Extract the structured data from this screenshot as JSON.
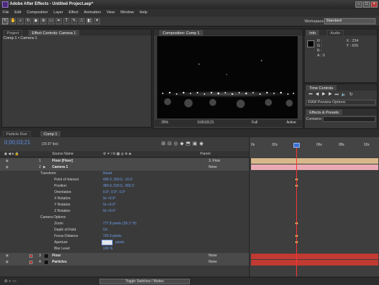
{
  "window": {
    "title": "Adobe After Effects - Untitled Project.aep*",
    "buttons": [
      "–",
      "□",
      "×"
    ]
  },
  "menu": [
    "File",
    "Edit",
    "Composition",
    "Layer",
    "Effect",
    "Animation",
    "View",
    "Window",
    "Help"
  ],
  "toolbar": {
    "tools": [
      "selection-tool",
      "hand-tool",
      "zoom-tool",
      "rotation-tool",
      "camera-tool",
      "pan-behind-tool",
      "mask-tool",
      "pen-tool",
      "text-tool",
      "brush-tool",
      "clone-stamp-tool",
      "eraser-tool",
      "puppet-tool"
    ],
    "workspace_label": "Workspace:",
    "workspace_value": "Standard"
  },
  "project_panel": {
    "tabs": [
      "Project",
      "Effect Controls: Camera 1"
    ],
    "breadcrumb": "Comp 1 • Camera 1"
  },
  "comp_panel": {
    "tab": "Composition: Comp 1",
    "footer": {
      "zoom": "25%",
      "timecode": "0;00;03;21",
      "resolution": "Full",
      "view": "Active"
    }
  },
  "info_panel": {
    "tabs": [
      "Info",
      "Audio"
    ],
    "r": "R :",
    "g": "G :",
    "b": "B :",
    "a": "A : 0",
    "x": "X : 234",
    "y": "Y : 605"
  },
  "time_controls": {
    "tab": "Time Controls",
    "ram_preview": "RAM Preview Options"
  },
  "effects_panel": {
    "tab": "Effects & Presets",
    "contains_label": "Contains:"
  },
  "lower_tabs": [
    "Particle Run",
    "Comp 1"
  ],
  "timeline": {
    "timecode": "0;00;03;21",
    "fps": "(29.97 fps)",
    "columns": {
      "source": "Source Name",
      "parent": "Parent"
    },
    "ruler_labels": [
      "0s",
      "02s",
      "04s",
      "06s",
      "08s",
      "10s"
    ],
    "rows": [
      {
        "num": "1",
        "name": "Floor [Floor]",
        "parent": "3. Floor"
      },
      {
        "num": "2",
        "name": "Camera 1",
        "parent": "None"
      },
      {
        "prop": "Transform",
        "value": "Reset"
      },
      {
        "prop": "Point of Interest",
        "value": "495.0, 369.0, -16.0"
      },
      {
        "prop": "Position",
        "value": "384.0, 520.0, -992.0"
      },
      {
        "prop": "Orientation",
        "value": "0.0°, 0.0°, 0.0°"
      },
      {
        "prop": "X Rotation",
        "value": "0x +0.0°"
      },
      {
        "prop": "Y Rotation",
        "value": "0x +0.0°"
      },
      {
        "prop": "Z Rotation",
        "value": "0x +0.0°"
      },
      {
        "prop": "Camera Options",
        "value": ""
      },
      {
        "prop": "Zoom",
        "value": "777.8 pixels (39.1° H)"
      },
      {
        "prop": "Depth of Field",
        "value": "On"
      },
      {
        "prop": "Focus Distance",
        "value": "720.0 pixels"
      },
      {
        "prop": "Aperture",
        "value": "pixels"
      },
      {
        "prop": "Blur Level",
        "value": "100 %"
      },
      {
        "num": "3",
        "name": "Floor",
        "parent": "None"
      },
      {
        "num": "4",
        "name": "Particles",
        "parent": "None"
      }
    ],
    "toggle_label": "Toggle Switches / Modes"
  }
}
